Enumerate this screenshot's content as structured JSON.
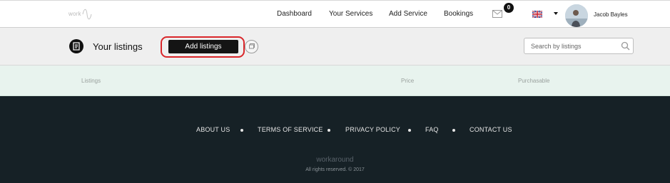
{
  "header": {
    "logo_text": "work",
    "nav": [
      "Dashboard",
      "Your Services",
      "Add Service",
      "Bookings"
    ],
    "mail_count": "0",
    "user_name": "Jacob Bayles",
    "icons": {
      "mail": "envelope-icon",
      "flag": "uk-flag-icon",
      "caret": "caret-down-icon"
    }
  },
  "toolbar": {
    "title": "Your listings",
    "add_label": "Add listings",
    "search_placeholder": "Search by listings"
  },
  "table": {
    "columns": [
      "Listings",
      "Price",
      "Purchasable"
    ]
  },
  "footer": {
    "links": [
      "ABOUT US",
      "TERMS OF SERVICE",
      "PRIVACY POLICY",
      "FAQ",
      "CONTACT US"
    ],
    "brand": "workaround",
    "copyright": "All rights reserved. © 2017"
  },
  "colors": {
    "highlight": "#d9262a",
    "footer_bg": "#162126",
    "table_header_bg": "#e8f3ee",
    "button_bg": "#141414"
  }
}
